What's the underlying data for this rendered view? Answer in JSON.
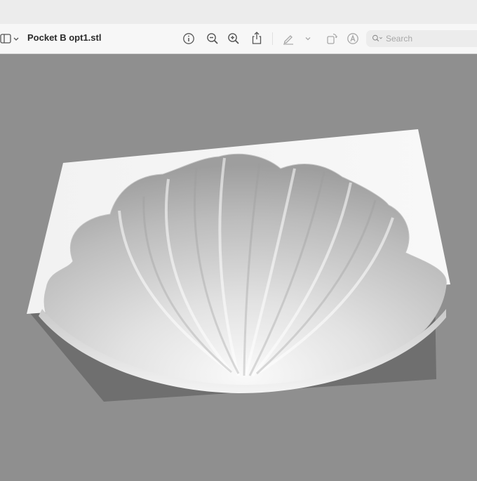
{
  "window": {
    "title": "Pocket B opt1.stl"
  },
  "toolbar": {
    "sidebar_toggle_icon": "sidebar-icon",
    "buttons": [
      {
        "name": "info",
        "icon": "info-circle-icon"
      },
      {
        "name": "zoom-out",
        "icon": "magnifier-minus-icon"
      },
      {
        "name": "zoom-in",
        "icon": "magnifier-plus-icon"
      },
      {
        "name": "share",
        "icon": "share-icon"
      },
      {
        "name": "markup",
        "icon": "pencil-icon"
      },
      {
        "name": "rotate",
        "icon": "rotate-icon"
      },
      {
        "name": "annotate",
        "icon": "circled-a-icon"
      }
    ],
    "search": {
      "placeholder": "Search",
      "value": ""
    }
  },
  "viewer": {
    "content": "3D STL model preview of a scallop-shell shaped pocket",
    "background": "#8f8f8f"
  }
}
